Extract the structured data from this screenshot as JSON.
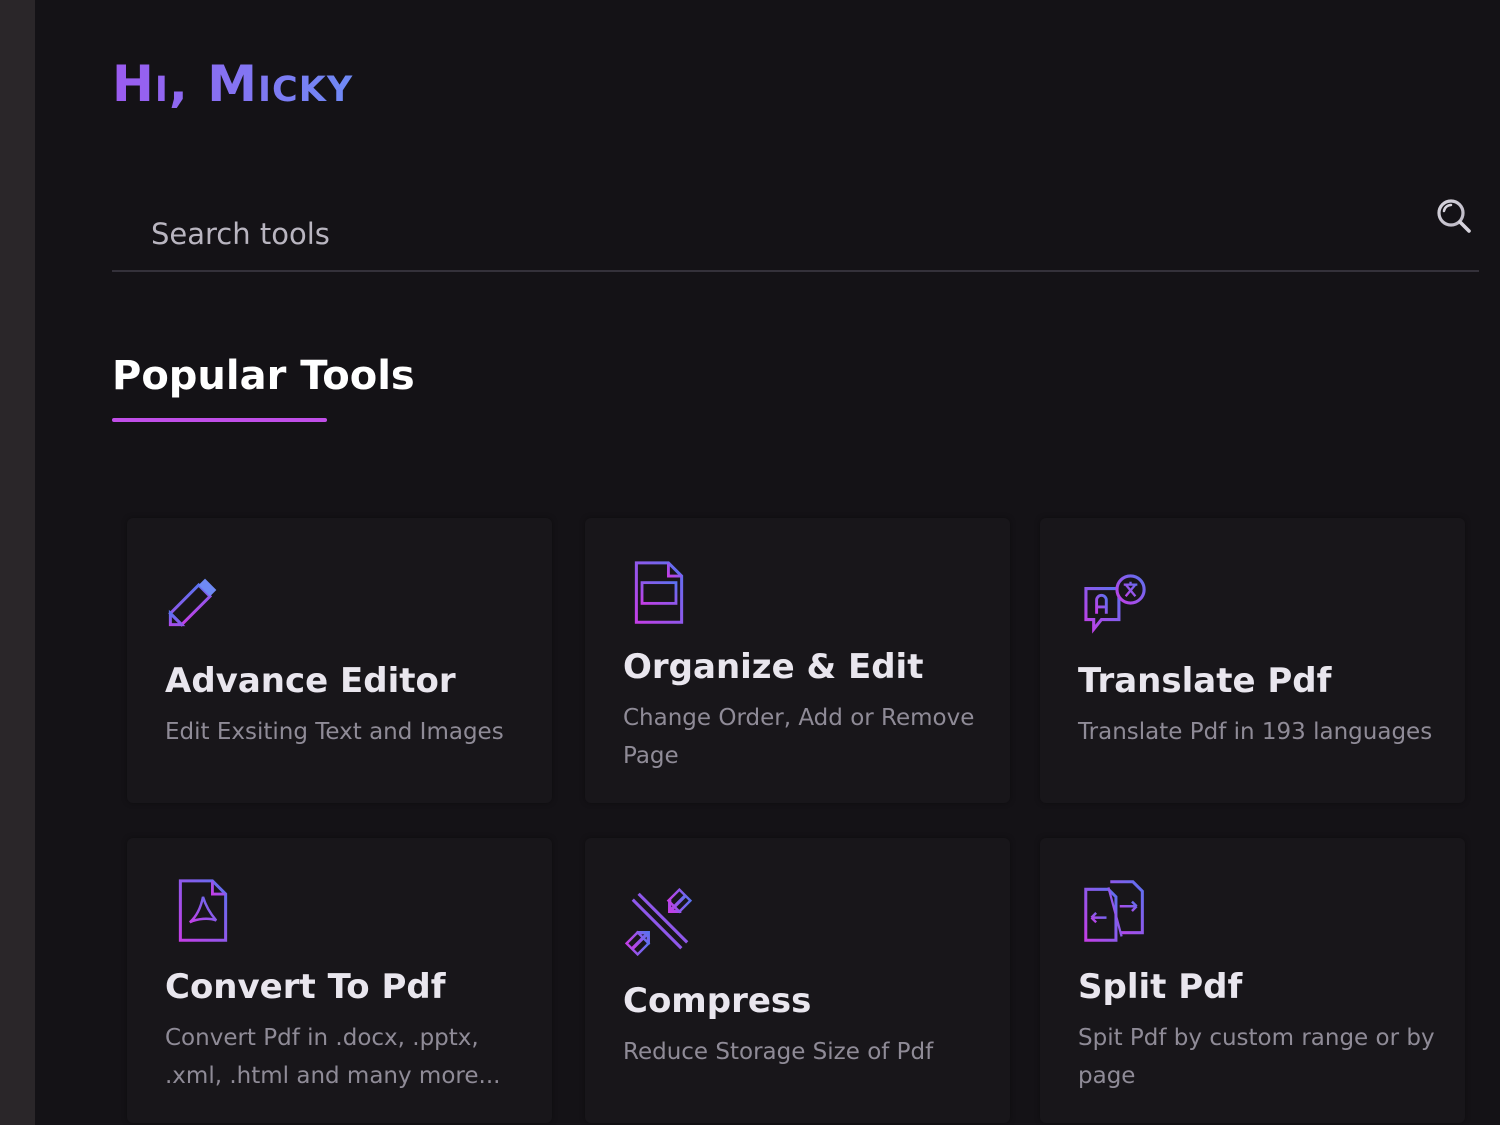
{
  "greeting": "Hi, Micky",
  "search": {
    "placeholder": "Search tools"
  },
  "section": {
    "title": "Popular Tools"
  },
  "tools": [
    {
      "title": "Advance Editor",
      "description": "Edit Exsiting Text and Images",
      "icon": "pencil-icon"
    },
    {
      "title": "Organize & Edit",
      "description": "Change Order, Add or Remove Page",
      "icon": "document-layout-icon"
    },
    {
      "title": "Translate Pdf",
      "description": "Translate Pdf in 193 languages",
      "icon": "translate-icon"
    },
    {
      "title": "Convert To Pdf",
      "description": "Convert Pdf in .docx, .pptx, .xml, .html and many more...",
      "icon": "pdf-file-icon"
    },
    {
      "title": "Compress",
      "description": "Reduce Storage Size of Pdf",
      "icon": "compress-icon"
    },
    {
      "title": "Split Pdf",
      "description": "Spit Pdf by custom range or by page",
      "icon": "split-file-icon"
    }
  ],
  "colors": {
    "background": "#141216",
    "card": "#18161a",
    "accent_purple": "#9b5bf0",
    "accent_blue": "#6f8af5",
    "underline": "#c04ee8"
  }
}
